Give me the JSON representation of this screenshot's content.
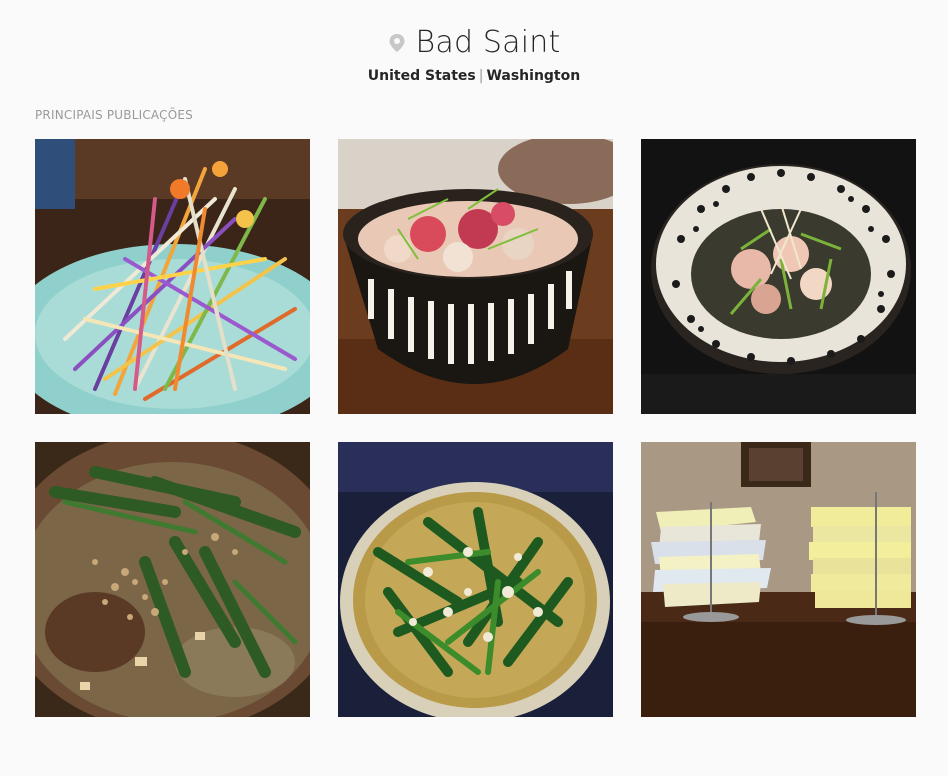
{
  "location": {
    "name": "Bad Saint",
    "country": "United States",
    "separator": "|",
    "city": "Washington",
    "icon": "map-pin-icon"
  },
  "section": {
    "label": "PRINCIPAIS PUBLICAÇÕES"
  },
  "posts": [
    {
      "id": "post-1",
      "subject": "colorful-slaw-plate"
    },
    {
      "id": "post-2",
      "subject": "poke-bowl-patterned"
    },
    {
      "id": "post-3",
      "subject": "salad-bowl-dark"
    },
    {
      "id": "post-4",
      "subject": "stew-clay-pot"
    },
    {
      "id": "post-5",
      "subject": "greens-rice-pot"
    },
    {
      "id": "post-6",
      "subject": "receipt-stacks"
    }
  ],
  "colors": {
    "background": "#fafafa",
    "text": "#262626",
    "muted": "#999999",
    "icon": "#c7c7c7"
  }
}
